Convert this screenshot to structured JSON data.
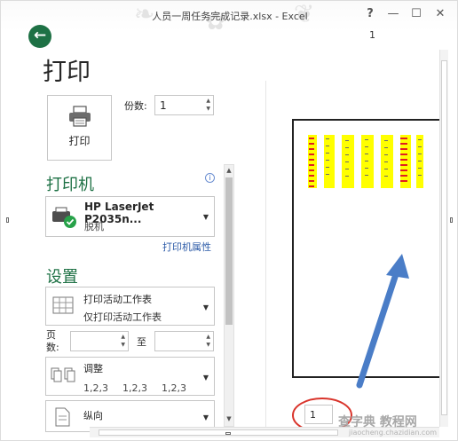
{
  "window": {
    "title": "人员一周任务完成记录.xlsx - Excel",
    "help": "?",
    "minimize": "—",
    "maximize": "☐",
    "close": "✕",
    "account_number": "1"
  },
  "backstage": {
    "back_icon": "back-arrow-icon",
    "page_title": "打印",
    "print_button_label": "打印",
    "copies_label": "份数:",
    "copies_value": "1"
  },
  "printer": {
    "section_title": "打印机",
    "info_icon": "i",
    "name": "HP LaserJet P2035n...",
    "status": "脱机",
    "properties_link": "打印机属性"
  },
  "settings": {
    "section_title": "设置",
    "scope_main": "打印活动工作表",
    "scope_sub": "仅打印活动工作表",
    "pages_label": "页数:",
    "to_label": "至",
    "collate_main": "调整",
    "collate_values": [
      "1,2,3",
      "1,2,3",
      "1,2,3"
    ],
    "orientation_main": "纵向"
  },
  "preview": {
    "page_number": "1"
  },
  "watermark": {
    "text": "查字典 教程网",
    "sub": "jiaocheng.chazidian.com"
  },
  "colors": {
    "accent_green": "#1e7145",
    "link_blue": "#2e5ca8",
    "sheet_yellow": "#ffff00",
    "sheet_red": "#e02020",
    "arrow_blue": "#4a7dc7",
    "annotation_red": "#d9342b"
  }
}
